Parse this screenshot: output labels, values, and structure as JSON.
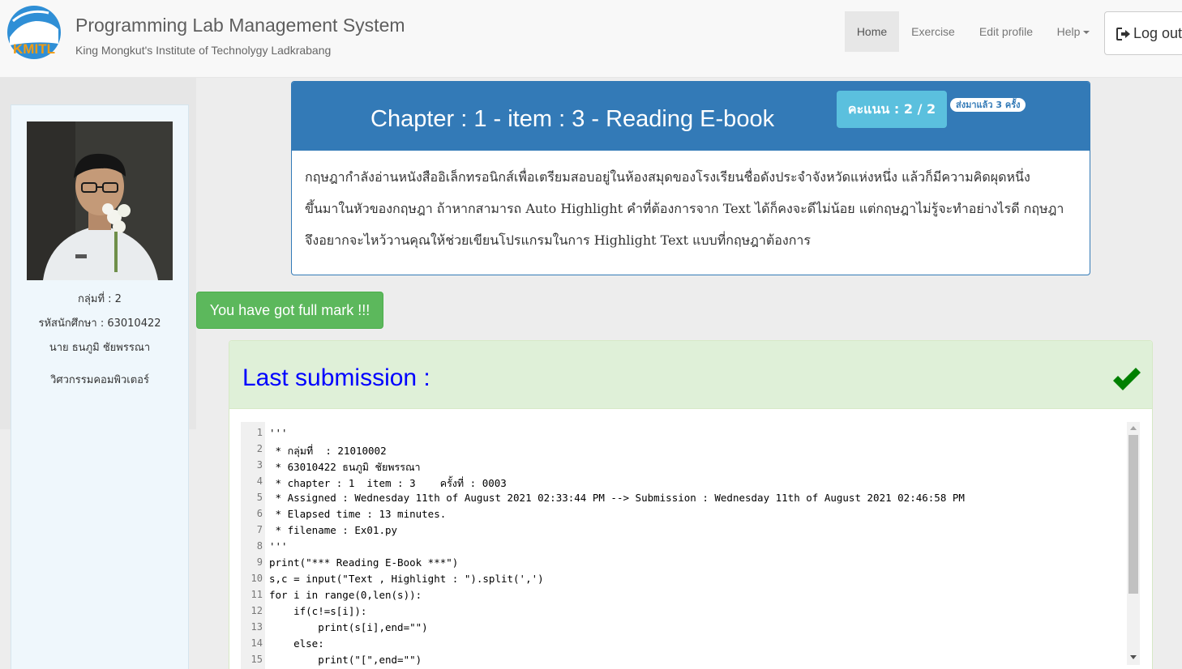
{
  "header": {
    "logo_text": "KMITL",
    "title": "Programming Lab Management System",
    "subtitle": "King Mongkut's Institute of Technolygy Ladkrabang",
    "nav": {
      "home": "Home",
      "exercise": "Exercise",
      "edit_profile": "Edit profile",
      "help": "Help",
      "logout": "Log out"
    }
  },
  "profile": {
    "group": "กลุ่มที่ : 2",
    "student_id": "รหัสนักศึกษา : 63010422",
    "name": "นาย ธนภูมิ ชัยพรรณา",
    "department": "วิศวกรรมคอมพิวเตอร์"
  },
  "chapter": {
    "title": "Chapter : 1 - item : 3 - Reading E-book",
    "score": "คะแนน : 2 / 2",
    "submitted_badge": "ส่งมาแล้ว 3 ครั้ง",
    "description_lines": [
      "กฤษฎากำลังอ่านหนังสืออิเล็กทรอนิกส์เพื่อเตรียมสอบอยู่ในห้องสมุดของโรงเรียนชื่อดังประจำจังหวัดแห่งหนึ่ง แล้วก็มีความคิดผุดหนึ่ง",
      "ขึ้นมาในหัวของกฤษฎา ถ้าหากสามารถ Auto Highlight คำที่ต้องการจาก Text ได้ก็คงจะดีไม่น้อย แต่กฤษฎาไม่รู้จะทำอย่างไรดี กฤษฎา",
      "จึงอยากจะไหว้วานคุณให้ช่วยเขียนโปรแกรมในการ Highlight Text แบบที่กฤษฎาต้องการ"
    ]
  },
  "fullmark": "You have got full mark !!!",
  "submission": {
    "title": "Last submission :",
    "status_icon": "checkmark-icon",
    "status_color": "#008000"
  },
  "code": {
    "line_numbers": [
      "1",
      "2",
      "3",
      "4",
      "5",
      "6",
      "7",
      "8",
      "9",
      "10",
      "11",
      "12",
      "13",
      "14",
      "15"
    ],
    "lines": [
      "'''",
      " * กลุ่มที่  : 21010002",
      " * 63010422 ธนภูมิ ชัยพรรณา",
      " * chapter : 1  item : 3    ครั้งที่ : 0003",
      " * Assigned : Wednesday 11th of August 2021 02:33:44 PM --> Submission : Wednesday 11th of August 2021 02:46:58 PM",
      " * Elapsed time : 13 minutes.",
      " * filename : Ex01.py",
      "'''",
      "print(\"*** Reading E-Book ***\")",
      "s,c = input(\"Text , Highlight : \").split(',')",
      "for i in range(0,len(s)):",
      "    if(c!=s[i]):",
      "        print(s[i],end=\"\")",
      "    else:",
      "        print(\"[\",end=\"\")"
    ]
  },
  "colors": {
    "primary": "#337ab7",
    "info": "#5bc0de",
    "success": "#5cb85c",
    "success_bg": "#dff0d8",
    "title_blue": "#0000ff"
  }
}
